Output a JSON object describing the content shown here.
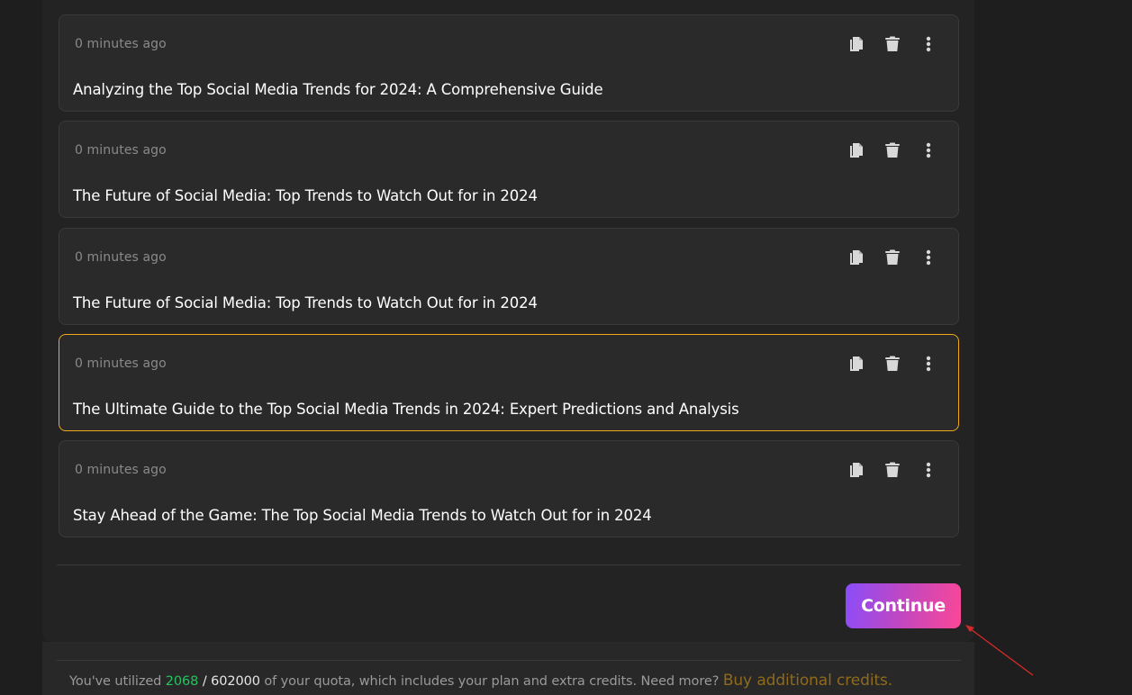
{
  "cards": [
    {
      "time": "0 minutes ago",
      "title": "Analyzing the Top Social Media Trends for 2024: A Comprehensive Guide",
      "selected": false
    },
    {
      "time": "0 minutes ago",
      "title": "The Future of Social Media: Top Trends to Watch Out for in 2024",
      "selected": false
    },
    {
      "time": "0 minutes ago",
      "title": "The Future of Social Media: Top Trends to Watch Out for in 2024",
      "selected": false
    },
    {
      "time": "0 minutes ago",
      "title": "The Ultimate Guide to the Top Social Media Trends in 2024: Expert Predictions and Analysis",
      "selected": true
    },
    {
      "time": "0 minutes ago",
      "title": "Stay Ahead of the Game: The Top Social Media Trends to Watch Out for in 2024",
      "selected": false
    }
  ],
  "card_actions": {
    "copy_icon": "copy-icon",
    "delete_icon": "trash-icon",
    "more_icon": "more-vertical-icon"
  },
  "continue_label": "Continue",
  "footer": {
    "prefix": "You've utilized ",
    "used": "2068",
    "separator": " / ",
    "total": "602000",
    "suffix": " of your quota, which includes your plan and extra credits. Need more? ",
    "buy_link": "Buy additional credits."
  },
  "colors": {
    "selected_border": "#f0a81c",
    "used_value": "#22c55e",
    "buy_link": "#8f6a1c",
    "button_gradient_start": "#8a4dfa",
    "button_gradient_end": "#fb4796",
    "annotation_arrow": "#d42a2a"
  }
}
